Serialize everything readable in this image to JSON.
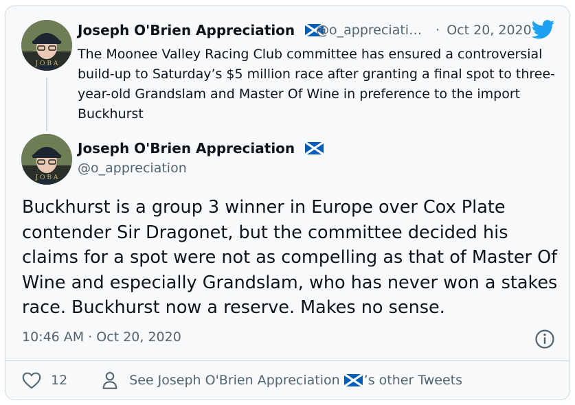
{
  "quoted_tweet": {
    "author_name": "Joseph O'Brien Appreciation",
    "handle": "@o_appreciati…",
    "separator": "·",
    "date": "Oct 20, 2020",
    "text": "The Moonee Valley Racing Club committee has ensured a controversial build-up to Saturday’s $5 million race after granting a final spot to three-year-old Grandslam and Master Of Wine in preference to the import Buckhurst"
  },
  "main_tweet": {
    "author_name": "Joseph O'Brien Appreciation",
    "handle": "@o_appreciation",
    "text": "Buckhurst is a group 3 winner in Europe over Cox Plate contender Sir Dragonet, but the committee decided his claims for a spot were not as compelling as that of Master Of Wine and especially Grandslam, who has never won a stakes race. Buckhurst now a reserve. Makes no sense.",
    "timestamp": "10:46 AM · Oct 20, 2020"
  },
  "footer": {
    "like_count": "12",
    "see_prefix": "See Joseph O'Brien Appreciation",
    "see_suffix": "’s other Tweets"
  },
  "icons": {
    "brand": "twitter-bird-icon",
    "flag": "scotland-flag-icon",
    "like": "heart-icon",
    "profile": "person-icon",
    "info": "info-icon"
  },
  "colors": {
    "twitter_blue": "#1da1f2",
    "secondary_text": "#536471",
    "flag_blue": "#005eb8",
    "border": "#cfd9de",
    "card_background": "#f7f9fa"
  }
}
